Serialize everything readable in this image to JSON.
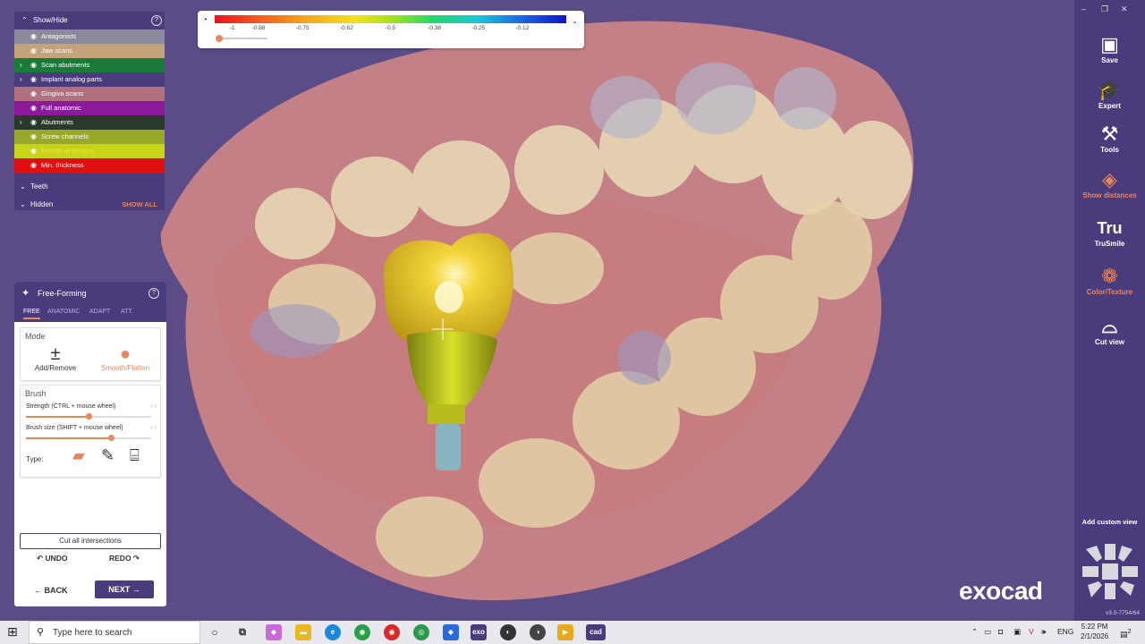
{
  "colorbar": {
    "gauge_icon": "gauge-icon",
    "ticks": [
      "-1",
      "-0.88",
      "-0.75",
      "-0.62",
      "-0.5",
      "-0.38",
      "-0.25",
      "-0.12"
    ]
  },
  "showhide": {
    "title": "Show/Hide",
    "layers": [
      {
        "label": "Antagonists",
        "color": "#8a8a9c",
        "expand": false
      },
      {
        "label": "Jaw scans",
        "color": "#c4a27a",
        "expand": false
      },
      {
        "label": "Scan abutments",
        "color": "#1a7a3a",
        "expand": true
      },
      {
        "label": "Implant analog parts",
        "color": "#4a3b7c",
        "expand": true
      },
      {
        "label": "Gingiva scans",
        "color": "#b0707e",
        "expand": false
      },
      {
        "label": "Full anatomic",
        "color": "#8a1a9a",
        "expand": false
      },
      {
        "label": "Abutments",
        "color": "#2a3a2a",
        "expand": true
      },
      {
        "label": "Screw channels",
        "color": "#9aa82a",
        "expand": false
      },
      {
        "label": "Bottom of designs",
        "color": "#c8d418",
        "expand": false
      },
      {
        "label": "Min. thickness",
        "color": "#e01010",
        "expand": false
      }
    ],
    "teeth_label": "Teeth",
    "hidden_label": "Hidden",
    "show_all_label": "SHOW ALL"
  },
  "freeforming": {
    "title": "Free-Forming",
    "tabs": [
      "FREE",
      "ANATOMIC",
      "ADAPT",
      "ATT."
    ],
    "mode_label": "Mode",
    "add_remove_label": "Add/Remove",
    "smooth_label": "Smooth/Flatten",
    "brush_label": "Brush",
    "strength_label": "Strength (CTRL + mouse wheel)",
    "strength_value": 0.5,
    "size_label": "Brush size (SHIFT + mouse wheel)",
    "size_value": 0.68,
    "type_label": "Type:",
    "cut_label": "Cut all intersections",
    "undo_label": "UNDO",
    "redo_label": "REDO",
    "back_label": "BACK",
    "next_label": "NEXT"
  },
  "toolbar": {
    "items": [
      {
        "label": "Save",
        "icon": "save-icon"
      },
      {
        "label": "Expert",
        "icon": "graduation-cap-icon"
      },
      {
        "label": "Tools",
        "icon": "tools-icon"
      },
      {
        "label": "Show distances",
        "icon": "show-distances-icon"
      },
      {
        "label": "TruSmile",
        "icon": "trusmile-icon"
      },
      {
        "label": "Color/Texture",
        "icon": "color-texture-icon"
      },
      {
        "label": "Cut view",
        "icon": "cut-view-icon"
      }
    ],
    "add_custom_view": "Add custom view",
    "version": "v3.0-7754/64"
  },
  "logo": "exocad",
  "taskbar": {
    "search_placeholder": "Type here to search",
    "lang": "ENG",
    "time": "5:22 PM",
    "date": "2/1/2026",
    "notification_count": "2"
  }
}
